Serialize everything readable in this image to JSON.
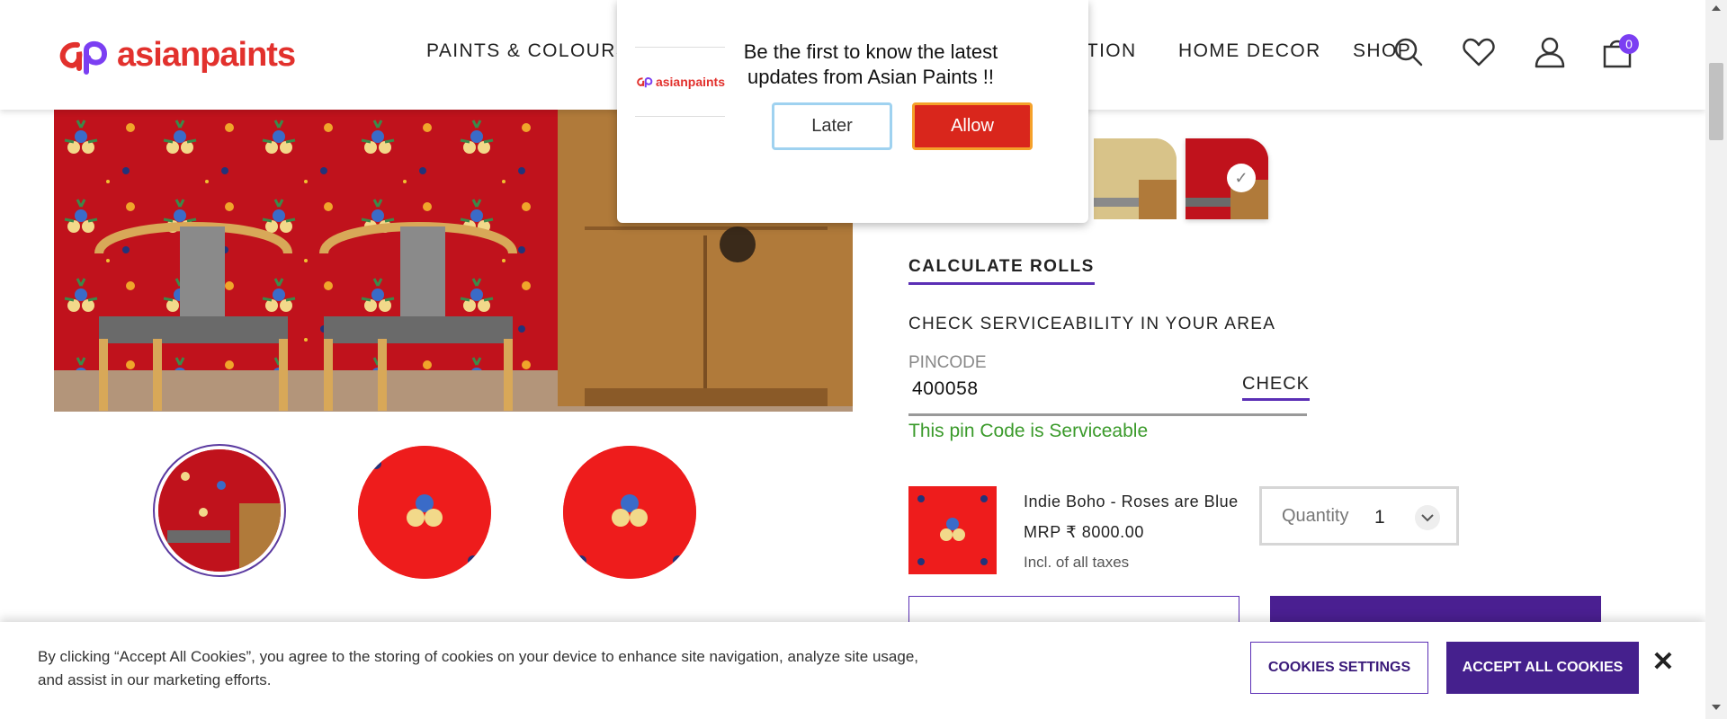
{
  "brand": {
    "logo_text": "asianpaints",
    "color": "#e2312d"
  },
  "nav": {
    "items": [
      "PAINTS & COLOURS",
      "ATION",
      "HOME DECOR",
      "SHOP"
    ]
  },
  "header_icons": [
    "search-icon",
    "wishlist-heart-icon",
    "user-icon",
    "cart-icon"
  ],
  "cart": {
    "count": "0"
  },
  "popup": {
    "logo_text": "asianpaints",
    "message": "Be the first to know the latest updates from Asian Paints !!",
    "later_label": "Later",
    "allow_label": "Allow"
  },
  "product": {
    "calculate_label": "CALCULATE ROLLS",
    "service_title": "CHECK SERVICEABILITY IN YOUR AREA",
    "pincode_label": "PINCODE",
    "pincode_value": "400058",
    "check_label": "CHECK",
    "service_status": "This pin Code is Serviceable",
    "name": "Indie Boho - Roses are Blue",
    "price": "MRP ₹ 8000.00",
    "tax_note": "Incl. of all taxes",
    "quantity_label": "Quantity",
    "quantity_value": "1"
  },
  "cookie": {
    "text": "By clicking “Accept All Cookies”, you agree to the storing of cookies on your device to enhance site navigation, analyze site usage, and assist in our marketing efforts.",
    "settings_label": "COOKIES SETTINGS",
    "accept_label": "ACCEPT ALL COOKIES",
    "close_icon": "close-icon"
  },
  "colors": {
    "accent_purple": "#4a1f91",
    "serviceable_green": "#3a9a2a",
    "allow_red": "#d9261c",
    "wallpaper_red": "#c0121c"
  }
}
